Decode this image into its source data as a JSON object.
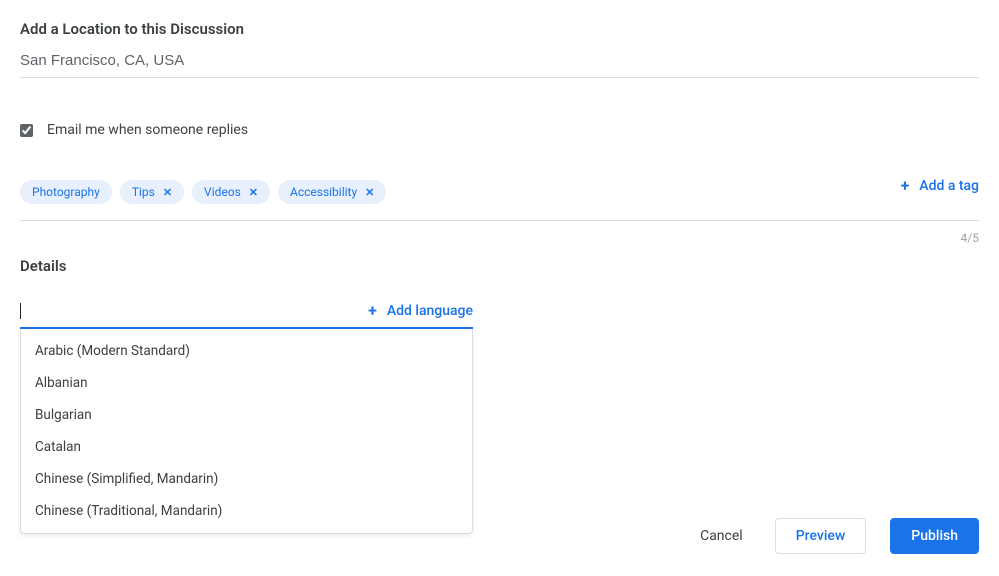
{
  "location": {
    "heading": "Add a Location to this Discussion",
    "value": "San Francisco, CA, USA"
  },
  "email_notify": {
    "checked": true,
    "label": "Email me when someone replies"
  },
  "tags": {
    "items": [
      {
        "label": "Photography",
        "removable": false
      },
      {
        "label": "Tips",
        "removable": true
      },
      {
        "label": "Videos",
        "removable": true
      },
      {
        "label": "Accessibility",
        "removable": true
      }
    ],
    "add_label": "Add a tag",
    "counter": "4/5"
  },
  "details": {
    "heading": "Details",
    "add_language_label": "Add language",
    "search_value": "",
    "dropdown": [
      "Arabic (Modern Standard)",
      "Albanian",
      "Bulgarian",
      "Catalan",
      "Chinese (Simplified, Mandarin)",
      "Chinese (Traditional, Mandarin)"
    ]
  },
  "footer": {
    "cancel": "Cancel",
    "preview": "Preview",
    "publish": "Publish"
  }
}
